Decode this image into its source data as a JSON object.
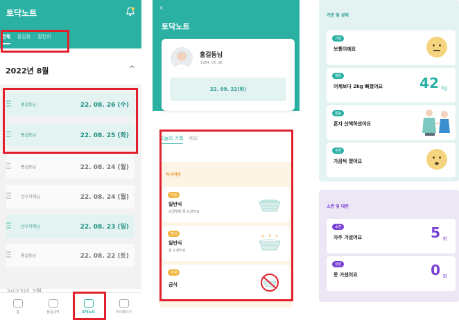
{
  "colors": {
    "teal": "#2bb1a4",
    "red_highlight": "#e0212b",
    "orange": "#f1b43e",
    "purple": "#7a3fd6"
  },
  "list_screen": {
    "title": "토닥노트",
    "tabs": [
      {
        "label": "전체",
        "active": true
      },
      {
        "label": "홍길동",
        "active": false
      },
      {
        "label": "황진희",
        "active": false
      }
    ],
    "month": "2022년 8월",
    "rows": [
      {
        "name": "홍길동님",
        "date": "22. 08. 26 (수)",
        "active": true
      },
      {
        "name": "홍길동님",
        "date": "22. 08. 25 (화)",
        "active": true
      },
      {
        "name": "홍길동님",
        "date": "22. 08. 24 (월)",
        "active": false
      },
      {
        "name": "선우지혜님",
        "date": "22. 08. 24 (월)",
        "active": false
      },
      {
        "name": "선우지혜님",
        "date": "22. 08. 23 (일)",
        "active": true
      },
      {
        "name": "홍길동님",
        "date": "22. 08. 22 (토)",
        "active": false
      }
    ],
    "next_month_partial": "2022년 7월",
    "nav": [
      {
        "label": "홈",
        "icon": "home-icon",
        "active": false
      },
      {
        "label": "돌봄내역",
        "icon": "calendar-icon",
        "active": false
      },
      {
        "label": "토닥노트",
        "icon": "note-icon",
        "active": true
      },
      {
        "label": "마이페이지",
        "icon": "user-icon",
        "active": false
      }
    ]
  },
  "detail_screen": {
    "back": "‹",
    "title": "토닥노트",
    "patient_name": "홍길동님",
    "birth": "1954. 05. 26",
    "date": "22. 09. 22(화)",
    "tabs": [
      {
        "label": "오늘의 기록",
        "active": true
      },
      {
        "label": "메모",
        "active": false
      }
    ],
    "section_title": "식사여부",
    "meals": [
      {
        "badge": "아침",
        "name": "일반식",
        "sub": "조금밖에 못 드셨어요"
      },
      {
        "badge": "점심",
        "name": "일반식",
        "sub": "잘 드셨어요"
      },
      {
        "badge": "저녁",
        "name": "금식",
        "sub": ""
      }
    ]
  },
  "status_screen": {
    "section1_title": "기분 및 상태",
    "cards": [
      {
        "badge": "기분",
        "text": "보통이에요",
        "visual": "neutral-face-icon"
      },
      {
        "badge": "체중",
        "text": "어제보다 2kg 빠졌어요",
        "value": "42",
        "unit": "kg"
      },
      {
        "badge": "활동",
        "text": "혼자 산책하셨어요",
        "visual": "walking-illustration"
      },
      {
        "badge": "수면",
        "text": "가끔씩 깼어요",
        "visual": "sleepy-face-icon"
      }
    ],
    "section2_title": "소변 및 대변",
    "toilet_cards": [
      {
        "badge": "소변",
        "text": "자주 가셨어요",
        "value": "5",
        "unit": "회"
      },
      {
        "badge": "대변",
        "text": "못 가셨어요",
        "value": "0",
        "unit": "회"
      }
    ]
  }
}
